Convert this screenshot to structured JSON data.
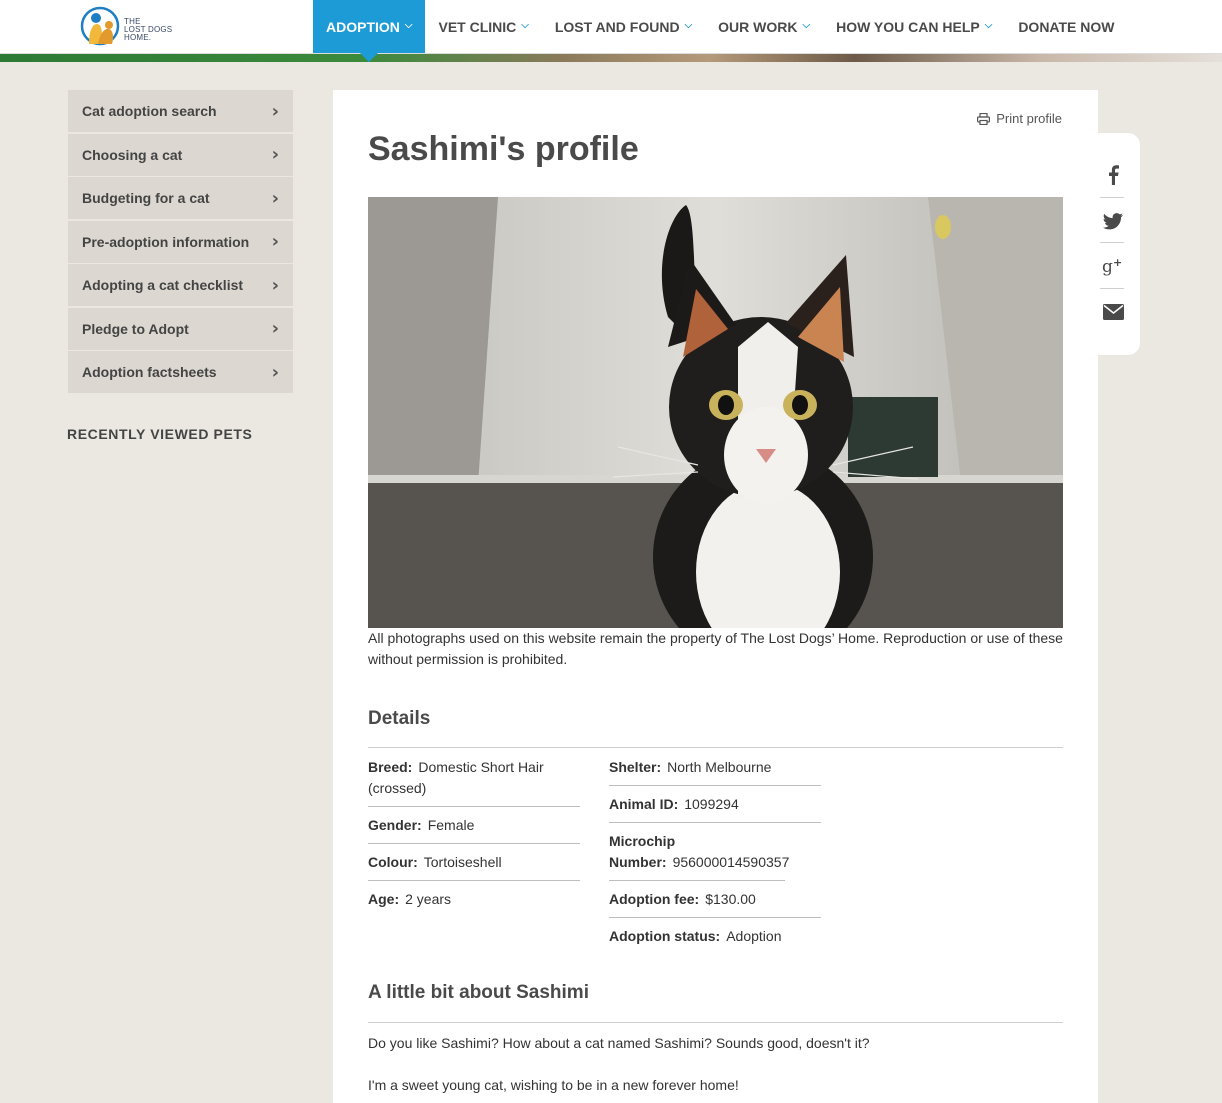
{
  "logo": {
    "line1": "THE",
    "line2": "LOST DOGS",
    "line3": "HOME."
  },
  "nav": {
    "items": [
      {
        "label": "ADOPTION"
      },
      {
        "label": "VET CLINIC"
      },
      {
        "label": "LOST AND FOUND"
      },
      {
        "label": "OUR WORK"
      },
      {
        "label": "HOW YOU CAN HELP"
      },
      {
        "label": "DONATE NOW"
      }
    ]
  },
  "sidebar": {
    "items": [
      {
        "label": "Cat adoption search"
      },
      {
        "label": "Choosing a cat"
      },
      {
        "label": "Budgeting for a cat"
      },
      {
        "label": "Pre-adoption information"
      },
      {
        "label": "Adopting a cat checklist"
      },
      {
        "label": "Pledge to Adopt"
      },
      {
        "label": "Adoption factsheets"
      }
    ],
    "recently_viewed_title": "RECENTLY VIEWED PETS"
  },
  "profile": {
    "print_label": "Print profile",
    "title": "Sashimi's profile",
    "photo_caption": "All photographs used on this website remain the property of The Lost Dogs’ Home. Reproduction or use of these without permission is prohibited.",
    "details_title": "Details",
    "details_left": [
      {
        "label": "Breed:",
        "value": "Domestic Short Hair (crossed)"
      },
      {
        "label": "Gender:",
        "value": "Female"
      },
      {
        "label": "Colour:",
        "value": "Tortoiseshell"
      },
      {
        "label": "Age:",
        "value": "2 years"
      }
    ],
    "details_right": [
      {
        "label": "Shelter:",
        "value": "North Melbourne"
      },
      {
        "label": "Animal ID:",
        "value": "1099294"
      },
      {
        "label": "Microchip Number:",
        "value": "956000014590357"
      },
      {
        "label": "Adoption fee:",
        "value": "$130.00"
      },
      {
        "label": "Adoption status:",
        "value": "Adoption"
      }
    ],
    "about_title": "A little bit about Sashimi",
    "about_paragraphs": [
      "Do you like Sashimi? How about a cat named Sashimi? Sounds good, doesn't it?",
      "I'm a sweet young cat, wishing to be in a new forever home!"
    ]
  },
  "colors": {
    "accent": "#1d9bd6",
    "sidebar_bg": "#dcd8d1",
    "page_bg": "#ebe8e2"
  },
  "share": [
    "facebook-icon",
    "twitter-icon",
    "google-plus-icon",
    "email-icon"
  ]
}
